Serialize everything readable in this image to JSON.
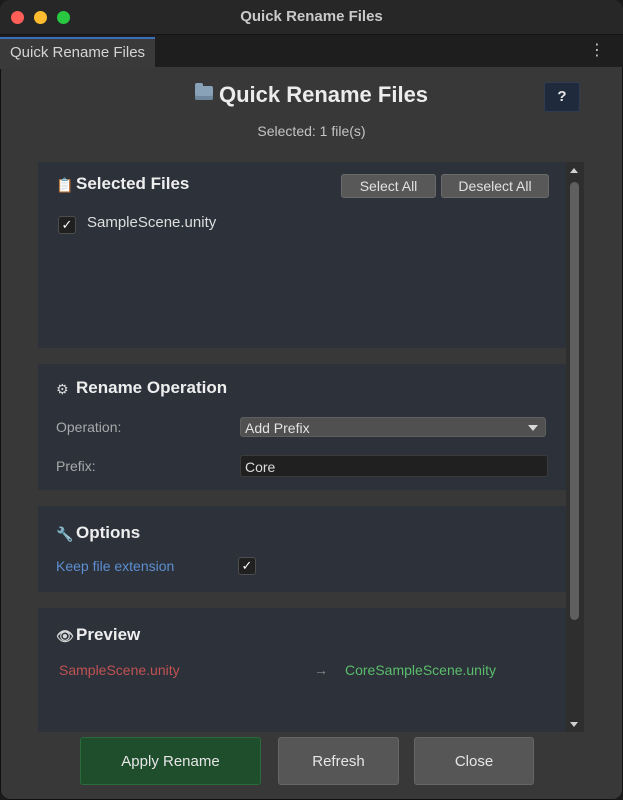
{
  "window": {
    "title": "Quick Rename Files"
  },
  "tab": {
    "label": "Quick Rename Files",
    "menu_icon": "more-vertical-icon"
  },
  "header": {
    "title": "Quick Rename Files",
    "help_label": "?",
    "selected_text": "Selected: 1 file(s)"
  },
  "selected_files": {
    "title": "Selected Files",
    "select_all_label": "Select All",
    "deselect_all_label": "Deselect All",
    "files": [
      {
        "name": "SampleScene.unity",
        "checked": true
      }
    ]
  },
  "rename_operation": {
    "title": "Rename Operation",
    "operation_label": "Operation:",
    "operation_value": "Add Prefix",
    "prefix_label": "Prefix:",
    "prefix_value": "Core"
  },
  "options": {
    "title": "Options",
    "keep_extension_label": "Keep file extension",
    "keep_extension_checked": true
  },
  "preview": {
    "title": "Preview",
    "old_name": "SampleScene.unity",
    "arrow": "→",
    "new_name": "CoreSampleScene.unity"
  },
  "footer": {
    "apply_label": "Apply Rename",
    "refresh_label": "Refresh",
    "close_label": "Close"
  },
  "colors": {
    "panel": "#2c313a",
    "old_name": "#c05252",
    "new_name": "#5bbd6b",
    "link_label": "#5d8fd1",
    "apply_button": "#1f4e2d"
  }
}
